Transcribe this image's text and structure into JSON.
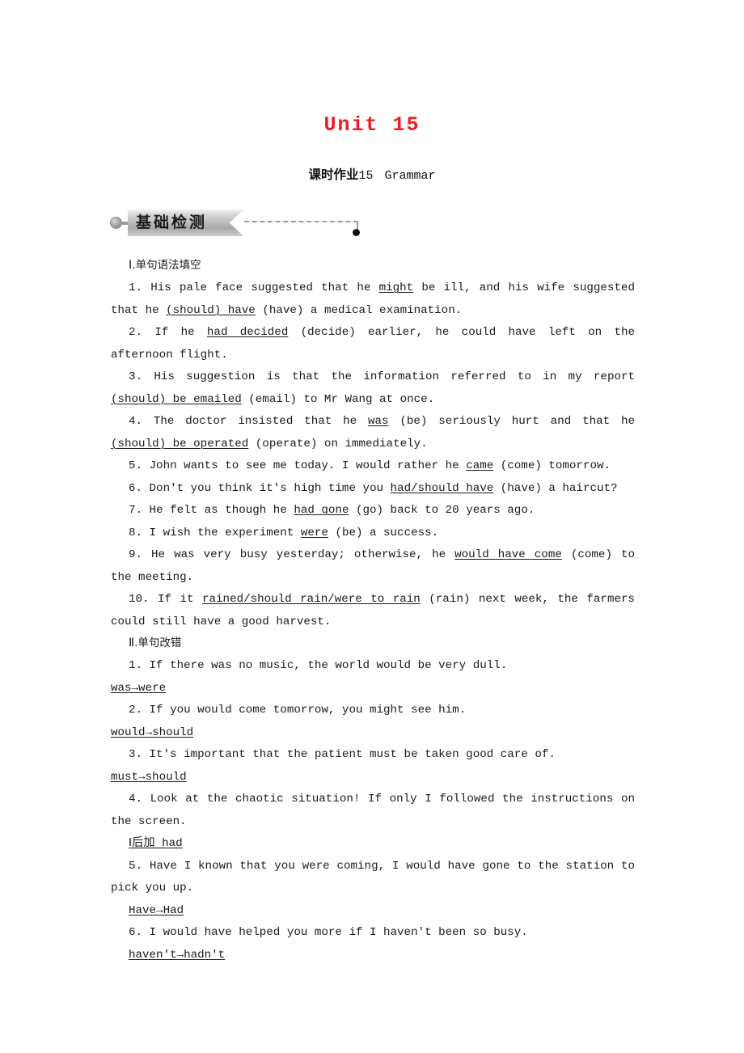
{
  "document": {
    "unit_title": "Unit 15",
    "worksheet": {
      "cn_label": "课时作业",
      "number": "15",
      "subject": "Grammar"
    },
    "banner": {
      "label": "基础检测"
    },
    "section_one": {
      "heading_numeral": "Ⅰ",
      "heading_text": ".单句语法填空",
      "items": [
        {
          "num": "1.",
          "parts": [
            {
              "t": "His pale face suggested that he ",
              "u": false
            },
            {
              "t": "might",
              "u": true
            },
            {
              "t": " be ill, and his wife suggested that he ",
              "u": false
            },
            {
              "t": "(should) have",
              "u": true
            },
            {
              "t": " (have) a medical examination.",
              "u": false
            }
          ]
        },
        {
          "num": "2.",
          "parts": [
            {
              "t": "If he ",
              "u": false
            },
            {
              "t": "had decided",
              "u": true
            },
            {
              "t": " (decide) earlier, he could have left on the afternoon flight.",
              "u": false
            }
          ]
        },
        {
          "num": "3.",
          "parts": [
            {
              "t": "His suggestion is that the information referred to in my report ",
              "u": false
            },
            {
              "t": "(should) be emailed",
              "u": true
            },
            {
              "t": " (email) to Mr Wang at once.",
              "u": false
            }
          ]
        },
        {
          "num": "4.",
          "parts": [
            {
              "t": "The doctor insisted that he ",
              "u": false
            },
            {
              "t": "was",
              "u": true
            },
            {
              "t": " (be) seriously hurt and that he ",
              "u": false
            },
            {
              "t": "(should) be operated",
              "u": true
            },
            {
              "t": " (operate) on immediately.",
              "u": false
            }
          ]
        },
        {
          "num": "5.",
          "parts": [
            {
              "t": "John wants to see me today. I would rather he ",
              "u": false
            },
            {
              "t": "came",
              "u": true
            },
            {
              "t": " (come) tomorrow.",
              "u": false
            }
          ]
        },
        {
          "num": "6.",
          "parts": [
            {
              "t": "Don't you think it's high time you ",
              "u": false
            },
            {
              "t": "had/should have",
              "u": true
            },
            {
              "t": " (have) a haircut?",
              "u": false
            }
          ]
        },
        {
          "num": "7.",
          "parts": [
            {
              "t": "He felt as though he ",
              "u": false
            },
            {
              "t": "had gone",
              "u": true
            },
            {
              "t": " (go) back to 20 years ago.",
              "u": false
            }
          ]
        },
        {
          "num": "8.",
          "parts": [
            {
              "t": "I wish the experiment ",
              "u": false
            },
            {
              "t": "were",
              "u": true
            },
            {
              "t": " (be) a success.",
              "u": false
            }
          ]
        },
        {
          "num": "9.",
          "parts": [
            {
              "t": "He was very busy yesterday; otherwise, he ",
              "u": false
            },
            {
              "t": "would have come",
              "u": true
            },
            {
              "t": " (come) to the meeting.",
              "u": false
            }
          ]
        },
        {
          "num": "10.",
          "parts": [
            {
              "t": "If it ",
              "u": false
            },
            {
              "t": "rained/should rain/were to rain",
              "u": true
            },
            {
              "t": " (rain) next week, the farmers could still have a good harvest.",
              "u": false
            }
          ]
        }
      ]
    },
    "section_two": {
      "heading_numeral": "Ⅱ",
      "heading_text": ".单句改错",
      "items": [
        {
          "num": "1.",
          "sentence": "If there was no music, the world would be very dull.",
          "answer": "was→were",
          "answer_indent": false
        },
        {
          "num": "2.",
          "sentence": "If you would come tomorrow, you might see him.",
          "answer": "would→should",
          "answer_indent": false
        },
        {
          "num": "3.",
          "sentence": "It's important that the patient must be taken good care of.",
          "answer": "must→should",
          "answer_indent": false
        },
        {
          "num": "4.",
          "sentence": "Look at the chaotic situation! If only I followed the instructions on the screen.",
          "answer": "Ⅰ后加 had",
          "answer_indent": true
        },
        {
          "num": "5.",
          "sentence": "Have I known that you were coming, I would have gone to the station to pick you up.",
          "answer": "Have→Had",
          "answer_indent": true
        },
        {
          "num": "6.",
          "sentence": "I would have helped you more if I haven't been so busy.",
          "answer": "haven't→hadn't",
          "answer_indent": true
        }
      ]
    }
  },
  "colors": {
    "title_red": "#ee1b24",
    "text_black": "#1a1a1a",
    "banner_gray": "#bdbdbd"
  }
}
